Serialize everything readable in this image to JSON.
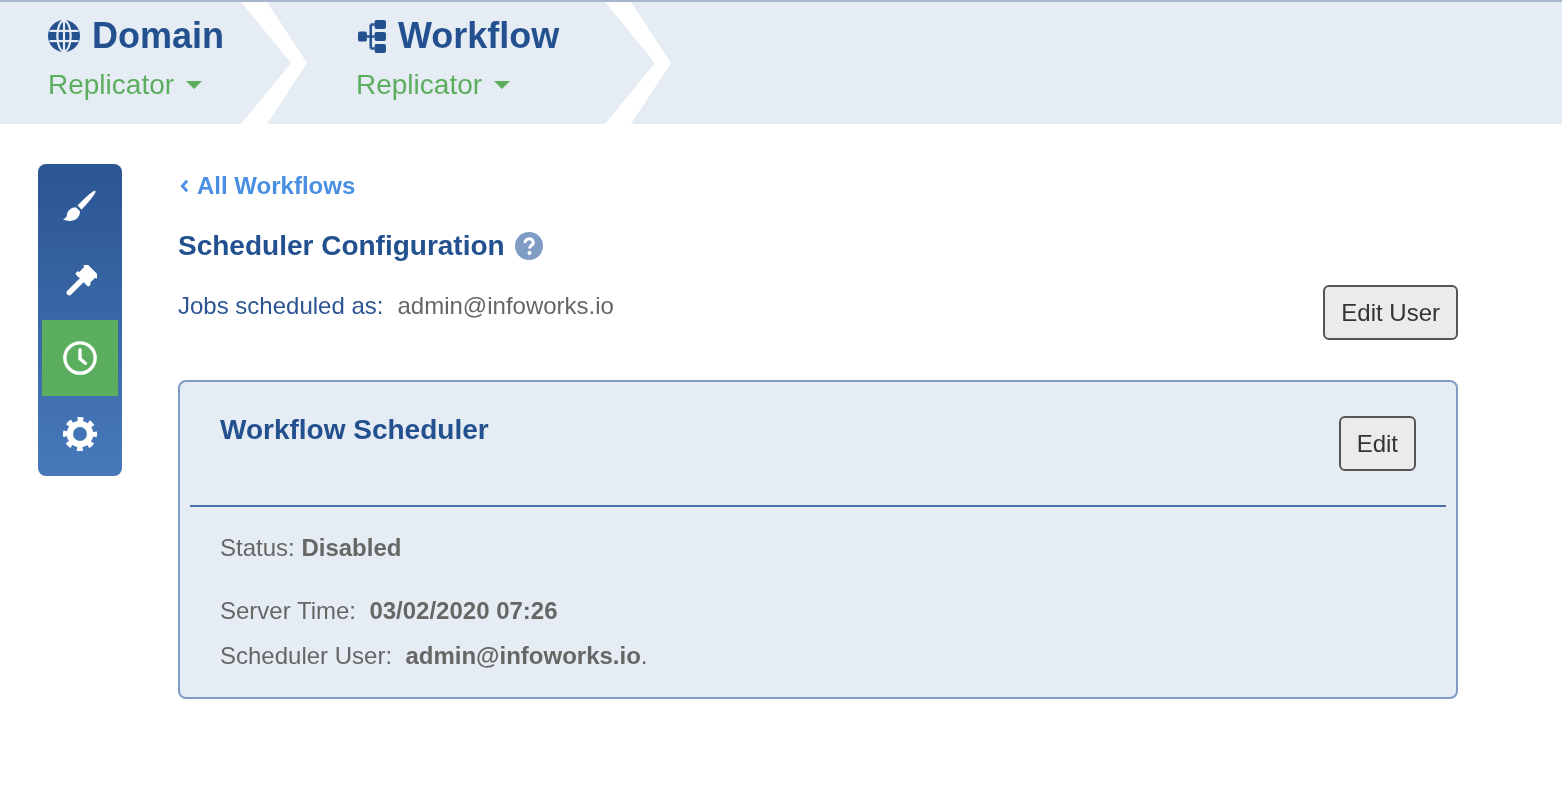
{
  "breadcrumb": [
    {
      "kind": "domain",
      "title": "Domain",
      "value": "Replicator"
    },
    {
      "kind": "workflow",
      "title": "Workflow",
      "value": "Replicator"
    }
  ],
  "sidebar": {
    "items": [
      {
        "kind": "brush",
        "selected": false
      },
      {
        "kind": "gavel",
        "selected": false
      },
      {
        "kind": "clock",
        "selected": true
      },
      {
        "kind": "gear",
        "selected": false
      }
    ]
  },
  "back_link": "All Workflows",
  "heading": "Scheduler Configuration",
  "jobs_scheduled": {
    "label": "Jobs scheduled as:",
    "value": "admin@infoworks.io",
    "button": "Edit User"
  },
  "scheduler_card": {
    "title": "Workflow Scheduler",
    "edit_button": "Edit",
    "status": "Status: **Disabled**",
    "details": [
      "Server Time:  **03/02/2020 07:26**",
      "Scheduler User:  **admin@infoworks.io**."
    ]
  }
}
